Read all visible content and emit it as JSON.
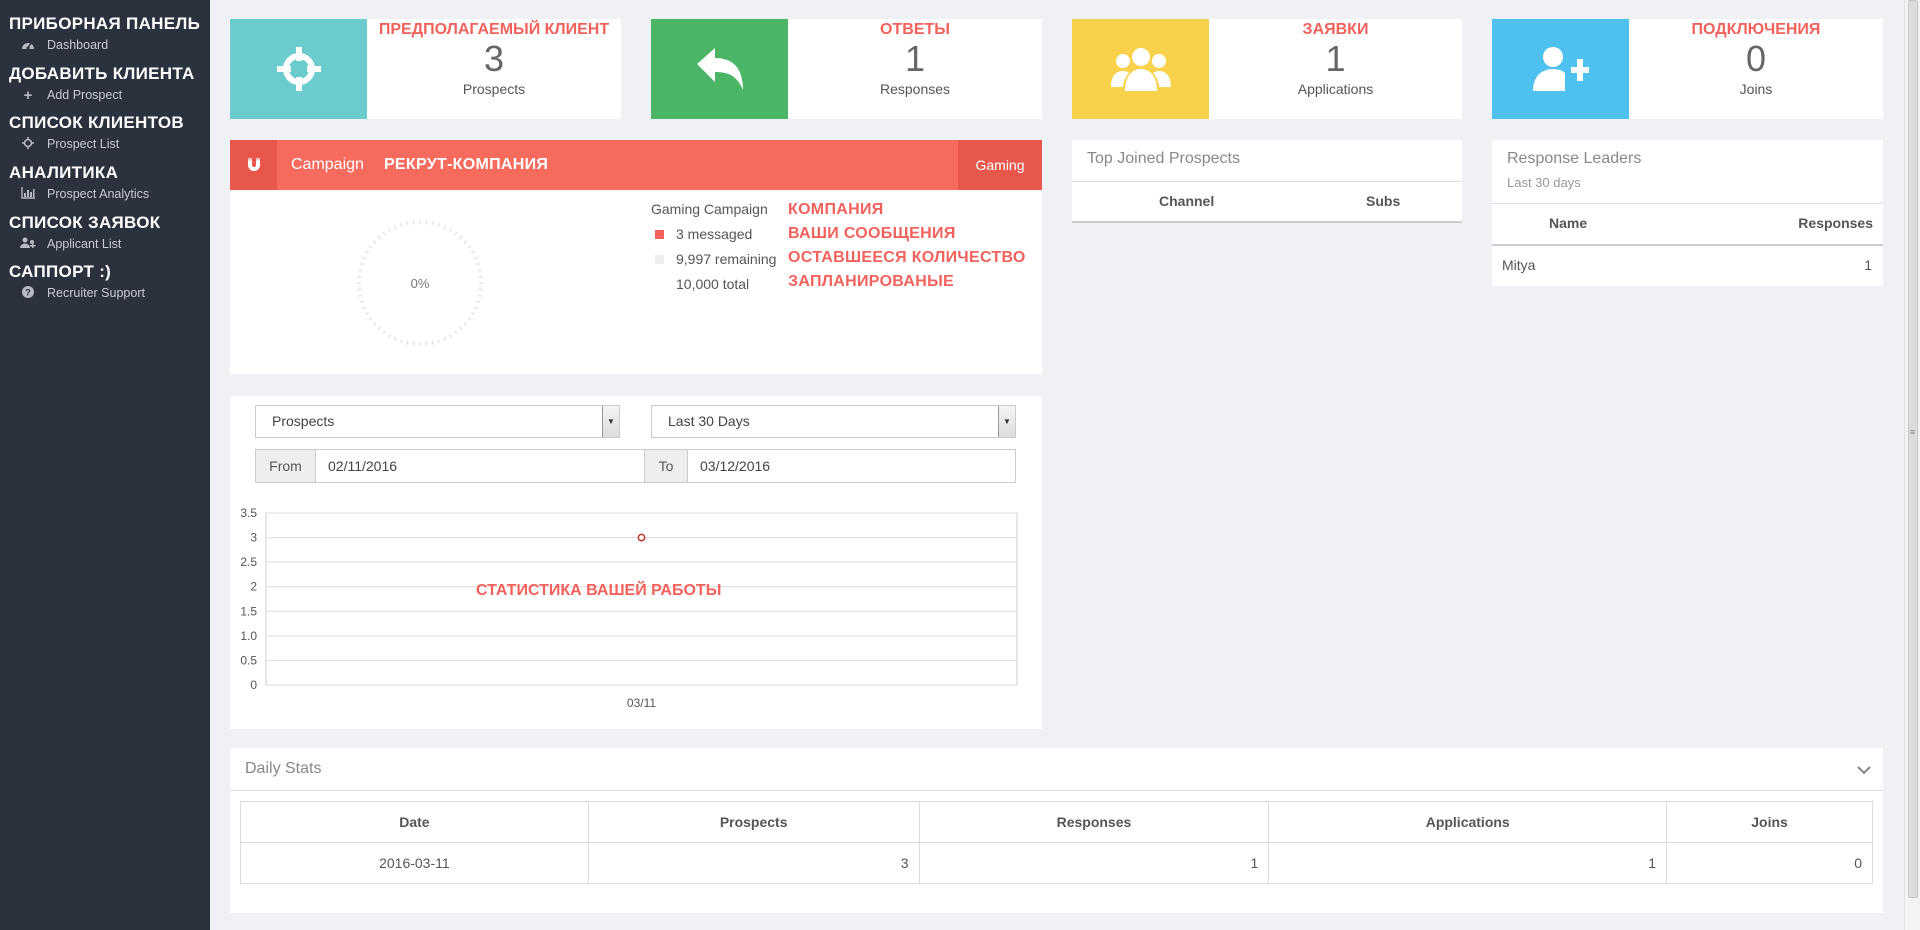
{
  "sidebar": {
    "groups": [
      {
        "heading": "ПРИБОРНАЯ ПАНЕЛЬ",
        "item": "Dashboard",
        "icon": "dashboard-icon"
      },
      {
        "heading": "ДОБАВИТЬ КЛИЕНТА",
        "item": "Add Prospect",
        "icon": "plus-icon"
      },
      {
        "heading": "СПИСОК КЛИЕНТОВ",
        "item": "Prospect List",
        "icon": "crosshair-icon"
      },
      {
        "heading": "АНАЛИТИКА",
        "item": "Prospect Analytics",
        "icon": "bar-chart-icon"
      },
      {
        "heading": "СПИСОК ЗАЯВОК",
        "item": "Applicant List",
        "icon": "user-group-icon"
      },
      {
        "heading": "САППОРТ :)",
        "item": "Recruiter Support",
        "icon": "question-circle-icon"
      }
    ]
  },
  "stats": [
    {
      "ru": "ПРЕДПОЛАГАЕМЫЙ КЛИЕНТ",
      "value": "3",
      "label": "Prospects",
      "color": "#6ccbcc",
      "icon": "crosshair-icon"
    },
    {
      "ru": "ОТВЕТЫ",
      "value": "1",
      "label": "Responses",
      "color": "#4bb566",
      "icon": "reply-icon"
    },
    {
      "ru": "ЗАЯВКИ",
      "value": "1",
      "label": "Applications",
      "color": "#f7d24a",
      "icon": "users-icon"
    },
    {
      "ru": "ПОДКЛЮЧЕНИЯ",
      "value": "0",
      "label": "Joins",
      "color": "#4fc1ef",
      "icon": "user-plus-icon"
    }
  ],
  "campaign": {
    "label": "Campaign",
    "name": "РЕКРУТ-КОМПАНИЯ",
    "tag": "Gaming",
    "percent": "0%",
    "progress": 0.0003,
    "title": "Gaming Campaign",
    "messaged": "3 messaged",
    "remaining": "9,997 remaining",
    "total": "10,000 total",
    "notes": [
      "КОМПАНИЯ",
      "ВАШИ СООБЩЕНИЯ",
      "ОСТАВШЕЕСЯ КОЛИЧЕСТВО",
      "ЗАПЛАНИРОВАНЫЕ"
    ],
    "color_messaged": "#f2625c",
    "color_remaining": "#eeeeee"
  },
  "filters": {
    "metric": "Prospects",
    "range": "Last 30 Days",
    "from_label": "From",
    "from_value": "02/11/2016",
    "to_label": "To",
    "to_value": "03/12/2016"
  },
  "chart_data": {
    "type": "scatter",
    "annotation": "СТАТИСТИКА ВАШЕЙ РАБОТЫ",
    "x": [
      "03/11"
    ],
    "y": [
      3
    ],
    "yticks": [
      "3.5",
      "3",
      "2.5",
      "2",
      "1.5",
      "1.0",
      "0.5",
      "0"
    ],
    "ylim": [
      0,
      3.5
    ],
    "grid": true
  },
  "top_joined": {
    "title": "Top Joined Prospects",
    "columns": [
      "Channel",
      "Subs"
    ]
  },
  "leaders": {
    "title": "Response Leaders",
    "subtitle": "Last 30 days",
    "columns": [
      "Name",
      "Responses"
    ],
    "rows": [
      {
        "name": "Mitya",
        "responses": "1"
      }
    ]
  },
  "daily": {
    "title": "Daily Stats",
    "columns": [
      "Date",
      "Prospects",
      "Responses",
      "Applications",
      "Joins"
    ],
    "rows": [
      [
        "2016-03-11",
        "3",
        "1",
        "1",
        "0"
      ]
    ]
  }
}
